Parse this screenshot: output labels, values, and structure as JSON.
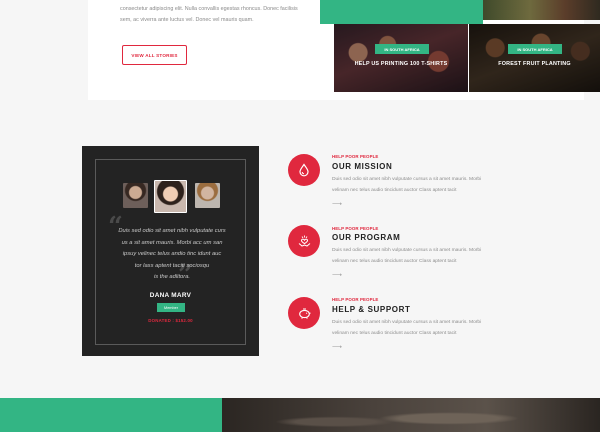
{
  "stories": {
    "text_lines": [
      "consectetur adipiscing elit. Nulla convallis egestas rhoncus. Donec facilisis",
      "sem, ac viverra ante luctus vel. Donec vel mauris quam."
    ],
    "button_label": "VIEW ALL STORIES",
    "cards": [
      {
        "tag": "IN SOUTH AFRICA",
        "title": "HELP US PRINTING 100 T-SHIRTS"
      },
      {
        "tag": "IN SOUTH AFRICA",
        "title": "FOREST FRUIT PLANTING"
      }
    ]
  },
  "testimonial": {
    "quote_lines": [
      "Duis sed odio sit amet nibh vulputate curs",
      "us a sit amet mauris. Morbi acc um san",
      "ipsuy velinec telus andio tinc idunt auc",
      "tor lass aptent taciti sociosqu",
      "is the adlitora."
    ],
    "name": "DANA MARV",
    "role": "Member",
    "donated": "DONATED : $152.00"
  },
  "features": [
    {
      "kicker": "HELP POOR PEOPLE",
      "title": "OUR MISSION",
      "text_lines": [
        "Duis sed odio sit amet nibh vulputate cursus a sit amet mauris. Morbi",
        "velinam nec telus audio tincidunt auctor Class aptent tacit"
      ],
      "icon": "drop-icon"
    },
    {
      "kicker": "HELP POOR PEOPLE",
      "title": "OUR PROGRAM",
      "text_lines": [
        "Duis sed odio sit amet nibh vulputate cursus a sit amet mauris. Morbi",
        "velinam nec telus audio tincidunt auctor Class aptent tacit"
      ],
      "icon": "hands-heart-icon"
    },
    {
      "kicker": "HELP POOR PEOPLE",
      "title": "HELP & SUPPORT",
      "text_lines": [
        "Duis sed odio sit amet nibh vulputate cursus a sit amet mauris. Morbi",
        "velinam nec telus audio tincidunt auctor Class aptent tacit"
      ],
      "icon": "piggy-bank-icon"
    }
  ],
  "arrow_glyph": "⟶",
  "colors": {
    "accent_red": "#e0283e",
    "accent_green": "#33b584",
    "dark_box": "#232323"
  }
}
